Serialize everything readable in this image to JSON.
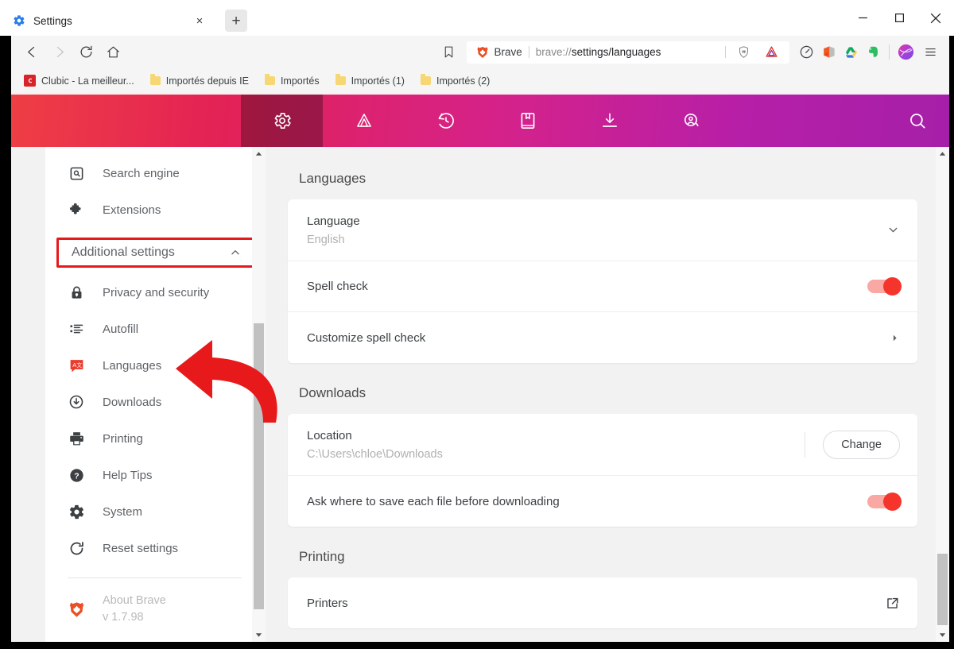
{
  "window": {
    "tab": {
      "title": "Settings",
      "favicon": "gear-icon",
      "close": "×"
    },
    "newtab_label": "+",
    "controls": {
      "minimize": "–",
      "maximize": "□",
      "close": "✕"
    }
  },
  "toolbar": {
    "back": "back-arrow",
    "forward": "forward-arrow",
    "reload": "reload-icon",
    "home": "home-icon",
    "bookmark": "bookmark-icon",
    "omnibox": {
      "brand": "Brave",
      "url_prefix": "brave://",
      "url_path": "settings/languages",
      "url_full": "brave://settings/languages"
    },
    "right_icons": [
      "brave-shields-icon",
      "bat-triangle-icon"
    ],
    "extensions": [
      "speedometer-icon",
      "office-icon",
      "google-drive-icon",
      "evernote-icon"
    ],
    "profile": "profile-avatar",
    "menu": "hamburger-menu-icon"
  },
  "bookmarks": [
    {
      "label": "Clubic - La meilleur...",
      "icon": "clubic-favicon"
    },
    {
      "label": "Importés depuis IE",
      "icon": "folder-icon"
    },
    {
      "label": "Importés",
      "icon": "folder-icon"
    },
    {
      "label": "Importés (1)",
      "icon": "folder-icon"
    },
    {
      "label": "Importés (2)",
      "icon": "folder-icon"
    }
  ],
  "banner": {
    "gradient_from": "#ef3e44",
    "gradient_to": "#a61fa8",
    "tabs": [
      {
        "name": "settings",
        "icon": "gear-icon",
        "active": true
      },
      {
        "name": "rewards",
        "icon": "bat-triangle-icon",
        "active": false
      },
      {
        "name": "history",
        "icon": "history-clock-icon",
        "active": false
      },
      {
        "name": "bookmarks",
        "icon": "bookmarks-book-icon",
        "active": false
      },
      {
        "name": "downloads",
        "icon": "download-icon",
        "active": false
      },
      {
        "name": "sync",
        "icon": "sync-profile-icon",
        "active": false
      }
    ],
    "search_icon": "search-icon"
  },
  "sidebar": {
    "top_items": [
      {
        "label": "Search engine",
        "icon": "search-box-icon"
      },
      {
        "label": "Extensions",
        "icon": "puzzle-piece-icon"
      }
    ],
    "additional": {
      "label": "Additional settings",
      "chevron": "chevron-up-icon",
      "highlight_color": "#e8191b"
    },
    "items": [
      {
        "label": "Privacy and security",
        "icon": "lock-icon"
      },
      {
        "label": "Autofill",
        "icon": "list-icon"
      },
      {
        "label": "Languages",
        "icon": "translate-icon"
      },
      {
        "label": "Downloads",
        "icon": "download-circle-icon"
      },
      {
        "label": "Printing",
        "icon": "printer-icon"
      },
      {
        "label": "Help Tips",
        "icon": "question-circle-icon"
      },
      {
        "label": "System",
        "icon": "gear-icon"
      },
      {
        "label": "Reset settings",
        "icon": "refresh-icon"
      }
    ],
    "about": {
      "title": "About Brave",
      "version": "v 1.7.98",
      "icon": "brave-lion-icon"
    }
  },
  "main": {
    "sections": [
      {
        "title": "Languages",
        "rows": [
          {
            "kind": "expand",
            "title": "Language",
            "sub": "English",
            "control": "chevron-down-icon"
          },
          {
            "kind": "toggle",
            "title": "Spell check",
            "control": "toggle-on"
          },
          {
            "kind": "link",
            "title": "Customize spell check",
            "control": "chevron-right-icon"
          }
        ]
      },
      {
        "title": "Downloads",
        "rows": [
          {
            "kind": "button",
            "title": "Location",
            "sub": "C:\\Users\\chloe\\Downloads",
            "button_label": "Change"
          },
          {
            "kind": "toggle",
            "title": "Ask where to save each file before downloading",
            "control": "toggle-on"
          }
        ]
      },
      {
        "title": "Printing",
        "rows": [
          {
            "kind": "external",
            "title": "Printers",
            "control": "external-link-icon"
          }
        ]
      }
    ]
  },
  "annotations": {
    "arrow": {
      "shape": "curved-left-arrow",
      "color": "#e8191b",
      "points_to": "Languages"
    },
    "box": {
      "shape": "rectangle-outline",
      "color": "#e8191b",
      "around": "Additional settings"
    }
  },
  "scrollbars": {
    "sidebar": {
      "up_arrow": "▲",
      "down_arrow": "▼"
    },
    "content": {
      "up_arrow": "▲",
      "down_arrow": "▼"
    }
  }
}
